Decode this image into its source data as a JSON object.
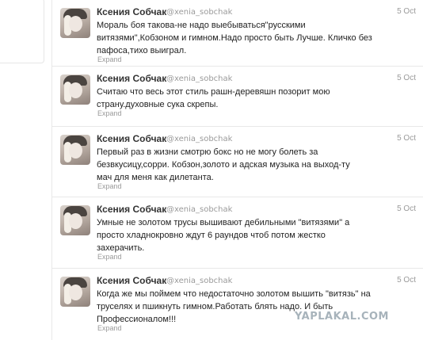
{
  "tweets": [
    {
      "name": "Ксения Собчак",
      "handle": "@xenia_sobchak",
      "date": "5 Oct",
      "text": "Мораль боя такова-не надо выебываться\"русскими витязями\",Кобзоном и гимном.Надо просто быть Лучше. Кличко без пафоса,тихо выиграл.",
      "expand": "Expand"
    },
    {
      "name": "Ксения Собчак",
      "handle": "@xenia_sobchak",
      "date": "5 Oct",
      "text": "Считаю что весь этот стиль рашн-деревяшн позорит мою страну.духовные сука скрепы.",
      "expand": "Expand"
    },
    {
      "name": "Ксения Собчак",
      "handle": "@xenia_sobchak",
      "date": "5 Oct",
      "text": "Первый раз в жизни смотрю бокс но не могу болеть за безвкусицу,сорри. Кобзон,золото и адская музыка на выход-ту мач для меня как дилетанта.",
      "expand": "Expand"
    },
    {
      "name": "Ксения Собчак",
      "handle": "@xenia_sobchak",
      "date": "5 Oct",
      "text": "Умные не золотом трусы вышивают дебильными \"витязями\" а просто хладнокровно ждут 6 раундов чтоб потом жестко захерачить.",
      "expand": "Expand"
    },
    {
      "name": "Ксения Собчак",
      "handle": "@xenia_sobchak",
      "date": "5 Oct",
      "text": "Когда же мы поймем что недостаточно золотом вышить \"витязь\" на труселях и пшикнуть гимном.Работать блять надо. И быть Профессионалом!!!",
      "expand": "Expand"
    }
  ],
  "watermark": "YAPLAKAL.COM"
}
